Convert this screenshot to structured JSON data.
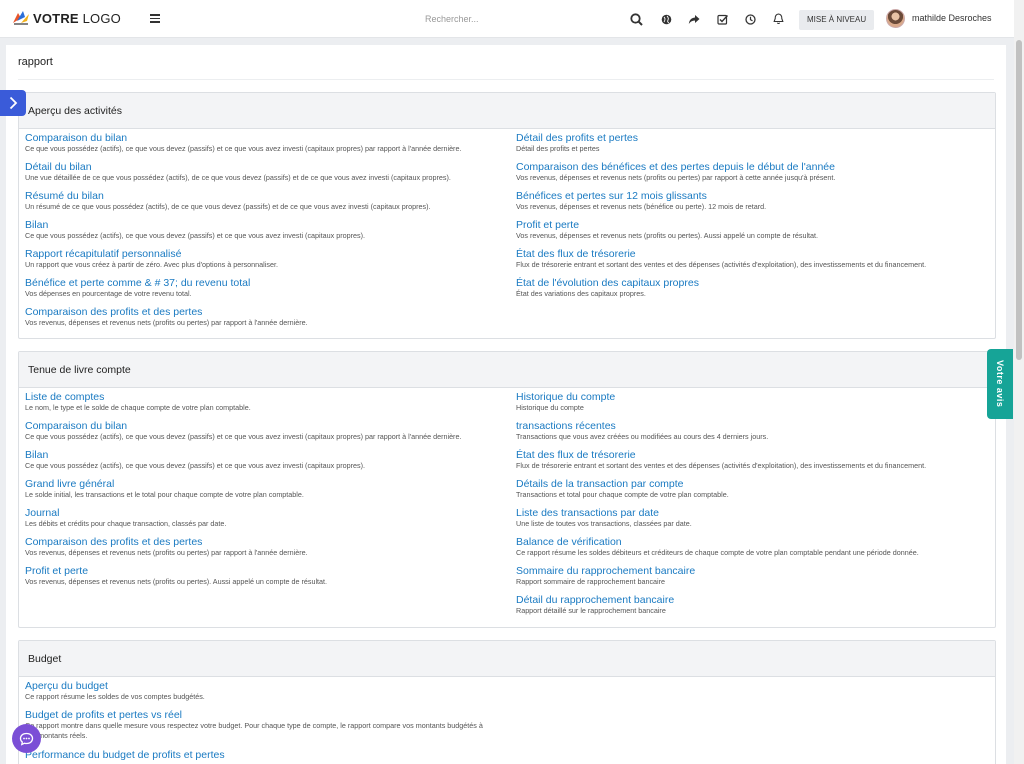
{
  "header": {
    "logo_bold": "VOTRE",
    "logo_light": " LOGO",
    "search_placeholder": "Rechercher...",
    "upgrade_label": "MISE À NIVEAU",
    "user_name": "mathilde Desroches",
    "icons": [
      "search-icon",
      "globe-icon",
      "share-icon",
      "checklist-icon",
      "clock-icon",
      "bell-icon"
    ]
  },
  "page": {
    "title": "rapport"
  },
  "feedback_label": "Votre avis",
  "colors": {
    "link": "#1a7ac2",
    "toggle": "#3a5bd9",
    "feedback": "#16a497",
    "chat": "#7b4fd6"
  },
  "sections": [
    {
      "title": "Aperçu des activités",
      "left": [
        {
          "title": "Comparaison du bilan",
          "desc": "Ce que vous possédez (actifs), ce que vous devez (passifs) et ce que vous avez investi (capitaux propres) par rapport à l'année dernière."
        },
        {
          "title": "Détail du bilan",
          "desc": "Une vue détaillée de ce que vous possédez (actifs), de ce que vous devez (passifs) et de ce que vous avez investi (capitaux propres)."
        },
        {
          "title": "Résumé du bilan",
          "desc": "Un résumé de ce que vous possédez (actifs), de ce que vous devez (passifs) et de ce que vous avez investi (capitaux propres)."
        },
        {
          "title": "Bilan",
          "desc": "Ce que vous possédez (actifs), ce que vous devez (passifs) et ce que vous avez investi (capitaux propres)."
        },
        {
          "title": "Rapport récapitulatif personnalisé",
          "desc": "Un rapport que vous créez à partir de zéro. Avec plus d'options à personnaliser."
        },
        {
          "title": "Bénéfice et perte comme & # 37; du revenu total",
          "desc": "Vos dépenses en pourcentage de votre revenu total."
        },
        {
          "title": "Comparaison des profits et des pertes",
          "desc": "Vos revenus, dépenses et revenus nets (profits ou pertes) par rapport à l'année dernière."
        }
      ],
      "right": [
        {
          "title": "Détail des profits et pertes",
          "desc": "Détail des profits et pertes"
        },
        {
          "title": "Comparaison des bénéfices et des pertes depuis le début de l'année",
          "desc": "Vos revenus, dépenses et revenus nets (profits ou pertes) par rapport à cette année jusqu'à présent."
        },
        {
          "title": "Bénéfices et pertes sur 12 mois glissants",
          "desc": "Vos revenus, dépenses et revenus nets (bénéfice ou perte). 12 mois de retard."
        },
        {
          "title": "Profit et perte",
          "desc": "Vos revenus, dépenses et revenus nets (profits ou pertes). Aussi appelé un compte de résultat."
        },
        {
          "title": "État des flux de trésorerie",
          "desc": "Flux de trésorerie entrant et sortant des ventes et des dépenses (activités d'exploitation), des investissements et du financement."
        },
        {
          "title": "État de l'évolution des capitaux propres",
          "desc": "État des variations des capitaux propres."
        }
      ]
    },
    {
      "title": "Tenue de livre compte",
      "left": [
        {
          "title": "Liste de comptes",
          "desc": "Le nom, le type et le solde de chaque compte de votre plan comptable."
        },
        {
          "title": "Comparaison du bilan",
          "desc": "Ce que vous possédez (actifs), ce que vous devez (passifs) et ce que vous avez investi (capitaux propres) par rapport à l'année dernière."
        },
        {
          "title": "Bilan",
          "desc": "Ce que vous possédez (actifs), ce que vous devez (passifs) et ce que vous avez investi (capitaux propres)."
        },
        {
          "title": "Grand livre général",
          "desc": "Le solde initial, les transactions et le total pour chaque compte de votre plan comptable."
        },
        {
          "title": "Journal",
          "desc": "Les débits et crédits pour chaque transaction, classés par date."
        },
        {
          "title": "Comparaison des profits et des pertes",
          "desc": "Vos revenus, dépenses et revenus nets (profits ou pertes) par rapport à l'année dernière."
        },
        {
          "title": "Profit et perte",
          "desc": "Vos revenus, dépenses et revenus nets (profits ou pertes). Aussi appelé un compte de résultat."
        }
      ],
      "right": [
        {
          "title": "Historique du compte",
          "desc": "Historique du compte"
        },
        {
          "title": "transactions récentes",
          "desc": "Transactions que vous avez créées ou modifiées au cours des 4 derniers jours."
        },
        {
          "title": "État des flux de trésorerie",
          "desc": "Flux de trésorerie entrant et sortant des ventes et des dépenses (activités d'exploitation), des investissements et du financement."
        },
        {
          "title": "Détails de la transaction par compte",
          "desc": "Transactions et total pour chaque compte de votre plan comptable."
        },
        {
          "title": "Liste des transactions par date",
          "desc": "Une liste de toutes vos transactions, classées par date."
        },
        {
          "title": "Balance de vérification",
          "desc": "Ce rapport résume les soldes débiteurs et créditeurs de chaque compte de votre plan comptable pendant une période donnée."
        },
        {
          "title": "Sommaire du rapprochement bancaire",
          "desc": "Rapport sommaire de rapprochement bancaire"
        },
        {
          "title": "Détail du rapprochement bancaire",
          "desc": "Rapport détaillé sur le rapprochement bancaire"
        }
      ]
    },
    {
      "title": "Budget",
      "left": [
        {
          "title": "Aperçu du budget",
          "desc": "Ce rapport résume les soldes de vos comptes budgétés."
        },
        {
          "title": "Budget de profits et pertes vs réel",
          "desc": "Ce rapport montre dans quelle mesure vous respectez votre budget. Pour chaque type de compte, le rapport compare vos montants budgétés à vos montants réels."
        },
        {
          "title": "Performance du budget de profits et pertes",
          "desc": ""
        }
      ],
      "right": []
    }
  ]
}
